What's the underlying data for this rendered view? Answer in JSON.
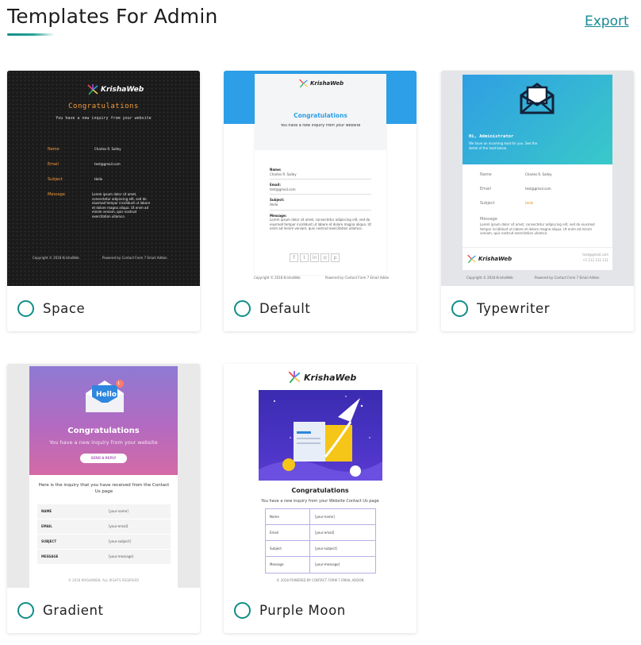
{
  "page": {
    "title": "Templates For Admin",
    "export_label": "Export",
    "accent_color": "#0f8d86"
  },
  "templates": [
    {
      "label": "Space",
      "preview": {
        "brand": "KrishaWeb",
        "heading": "Congratulations",
        "subheading": "You have a new inquiry from your website",
        "fields": [
          {
            "label": "Name",
            "value": "Charles R. Salley"
          },
          {
            "label": "Email",
            "value": "test@gmail.com"
          },
          {
            "label": "Subject",
            "value": "Hello"
          },
          {
            "label": "Message",
            "value": "Lorem ipsum dolor sit amet, consectetur adipiscing elit, sed do eiusmod tempor incididunt ut labore et dolore magna aliqua. Ut enim ad minim veniam, quis nostrud exercitation ullamco."
          }
        ],
        "footer_left": "Copyright © 2018 KrishaWeb",
        "footer_right": "Powered by Contact Form 7 Email Addon"
      }
    },
    {
      "label": "Default",
      "preview": {
        "brand": "KrishaWeb",
        "heading": "Congratulations",
        "subheading": "You have a new inquiry from your website",
        "fields": [
          {
            "label": "Name:",
            "value": "Charles R. Salley"
          },
          {
            "label": "Email:",
            "value": "test@gmail.com"
          },
          {
            "label": "Subject:",
            "value": "Hello"
          },
          {
            "label": "Message:",
            "value": "Lorem ipsum dolor sit amet, consectetur adipiscing elit, sed do eiusmod tempor incididunt ut labore et dolore magna aliqua. Ut enim ad minim veniam, quis nostrud exercitation ullamco."
          }
        ],
        "footer_left": "Copyright © 2018 KrishaWeb",
        "footer_right": "Powered by Contact Form 7 Email Addon"
      }
    },
    {
      "label": "Typewriter",
      "preview": {
        "greeting": "Hi, Administrator",
        "intro": "We have an incoming lead for you. See the detail of the lead below.",
        "fields": [
          {
            "label": "Name",
            "value": "Charles R. Salley"
          },
          {
            "label": "Email",
            "value": "test@gmail.com"
          },
          {
            "label": "Subject",
            "value": "Hello"
          }
        ],
        "message_label": "Message",
        "message": "Lorem ipsum dolor sit amet, consectetur adipiscing elit, sed do eiusmod tempor incididunt ut labore et dolore magna aliqua. Ut enim ad minim veniam, quis nostrud exercitation ullamco.",
        "brand": "KrishaWeb",
        "contact_email": "test@gmail.com",
        "contact_phone": "+1 111 111 111",
        "footer_left": "Copyright © 2018 KrishaWeb",
        "footer_right": "Powered by Contact Form 7 Email Addon"
      }
    },
    {
      "label": "Gradient",
      "preview": {
        "envelope_word": "Hello",
        "badge": "1",
        "heading": "Congratulations",
        "subheading": "You have a new inquiry from your website",
        "button": "SEND A REPLY",
        "intro": "Here is the inquiry that you have received from the Contact Us page",
        "rows": [
          {
            "label": "NAME",
            "value": "[your-name]"
          },
          {
            "label": "EMAIL",
            "value": "[your-email]"
          },
          {
            "label": "SUBJECT",
            "value": "[your-subject]"
          },
          {
            "label": "MESSAGE",
            "value": "[your-message]"
          }
        ],
        "footer": "© 2018 KRISHAWEB. ALL RIGHTS RESERVED"
      }
    },
    {
      "label": "Purple Moon",
      "preview": {
        "brand": "KrishaWeb",
        "heading": "Congratulations",
        "subheading": "You have a new inquiry from your Website Contact Us page",
        "rows": [
          {
            "label": "Name",
            "value": "[your-name]"
          },
          {
            "label": "Email",
            "value": "[your-email]"
          },
          {
            "label": "Subject",
            "value": "[your-subject]"
          },
          {
            "label": "Message",
            "value": "[your-message]"
          }
        ],
        "footer": "© 2018 POWERED BY CONTACT FORM 7 EMAIL ADDON"
      }
    }
  ]
}
